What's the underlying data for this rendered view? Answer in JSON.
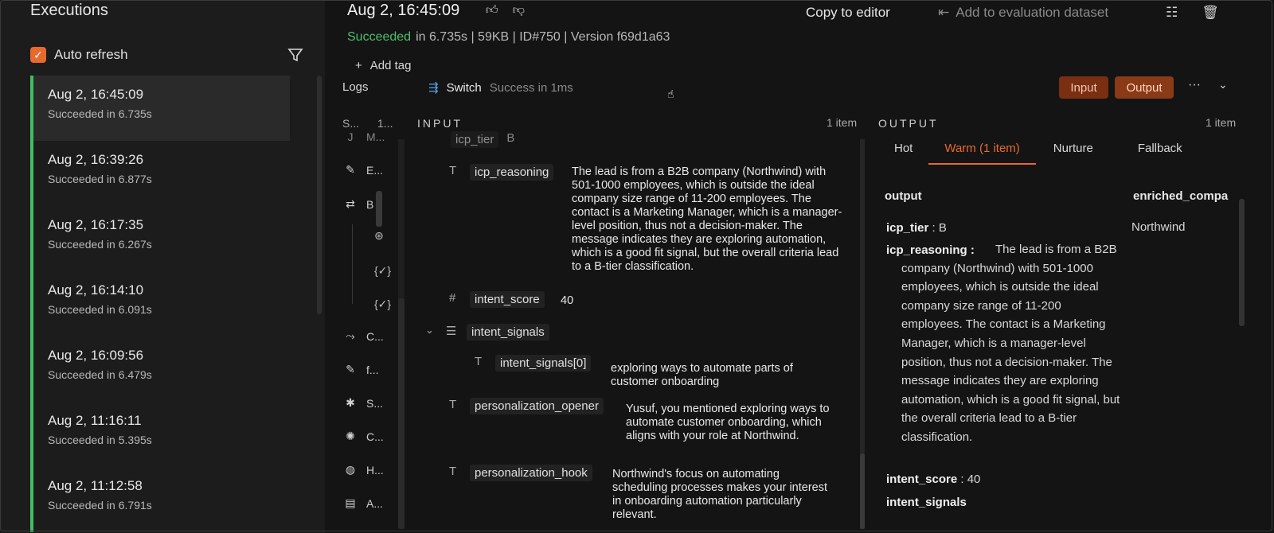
{
  "executions": {
    "title": "Executions",
    "auto_refresh_label": "Auto refresh",
    "items": [
      {
        "date": "Aug 2, 16:45:09",
        "status": "Succeeded in 6.735s"
      },
      {
        "date": "Aug 2, 16:39:26",
        "status": "Succeeded in 6.877s"
      },
      {
        "date": "Aug 2, 16:17:35",
        "status": "Succeeded in 6.267s"
      },
      {
        "date": "Aug 2, 16:14:10",
        "status": "Succeeded in 6.091s"
      },
      {
        "date": "Aug 2, 16:09:56",
        "status": "Succeeded in 6.479s"
      },
      {
        "date": "Aug 2, 11:16:11",
        "status": "Succeeded in 5.395s"
      },
      {
        "date": "Aug 2, 11:12:58",
        "status": "Succeeded in 6.791s"
      }
    ]
  },
  "header": {
    "date": "Aug 2, 16:45:09",
    "copy_to_editor": "Copy to editor",
    "add_to_eval": "Add to evaluation dataset",
    "status": "Succeeded",
    "meta_rest": "in 6.735s | 59KB | ID#750 | Version f69d1a63",
    "add_tag": "Add tag"
  },
  "logs": {
    "label": "Logs",
    "node_name": "Switch",
    "node_status": "Success in 1ms",
    "input_btn": "Input",
    "output_btn": "Output"
  },
  "tree": {
    "col1": "S...",
    "col2": "1...",
    "items": [
      {
        "icon": "J",
        "label": "M..."
      },
      {
        "icon": "✎",
        "label": "E..."
      },
      {
        "icon": "⇄",
        "label": "B"
      },
      {
        "icon": "⤳",
        "label": "C..."
      },
      {
        "icon": "✎",
        "label": "f..."
      },
      {
        "icon": "✱",
        "label": "S..."
      },
      {
        "icon": "✺",
        "label": "C..."
      },
      {
        "icon": "◍",
        "label": "H..."
      },
      {
        "icon": "▤",
        "label": "A..."
      }
    ]
  },
  "input": {
    "title": "INPUT",
    "count": "1 item",
    "partial_key": "icp_tier",
    "partial_val": "B",
    "icp_reasoning_key": "icp_reasoning",
    "icp_reasoning_val": "The lead is from a B2B company (Northwind) with 501-1000 employees, which is outside the ideal company size range of 11-200 employees. The contact is a Marketing Manager, which is a manager-level position, thus not a decision-maker. The message indicates they are exploring automation, which is a good fit signal, but the overall criteria lead to a B-tier classification.",
    "intent_score_key": "intent_score",
    "intent_score_val": "40",
    "intent_signals_key": "intent_signals",
    "intent_signals0_key": "intent_signals[0]",
    "intent_signals0_val": "exploring ways to automate parts of customer onboarding",
    "opener_key": "personalization_opener",
    "opener_val": "Yusuf, you mentioned exploring ways to automate customer onboarding, which aligns with your role at Northwind.",
    "hook_key": "personalization_hook",
    "hook_val": "Northwind's focus on automating scheduling processes makes your interest in onboarding automation particularly relevant."
  },
  "output": {
    "title": "OUTPUT",
    "count": "1 item",
    "tabs": [
      "Hot",
      "Warm (1 item)",
      "Nurture",
      "Fallback"
    ],
    "col_output": "output",
    "col_enriched": "enriched_compa",
    "enriched_val": "Northwind",
    "icp_tier_key": "icp_tier",
    "icp_tier_val": "B",
    "icp_reasoning_key": "icp_reasoning",
    "icp_reasoning_val": "The lead is from a B2B company (Northwind) with 501-1000 employees, which is outside the ideal company size range of 11-200 employees. The contact is a Marketing Manager, which is a manager-level position, thus not a decision-maker. The message indicates they are exploring automation, which is a good fit signal, but the overall criteria lead to a B-tier classification.",
    "intent_score_key": "intent_score",
    "intent_score_val": "40",
    "intent_signals_key": "intent_signals"
  },
  "colors": {
    "accent": "#e8692e",
    "success": "#3fbf5e"
  }
}
